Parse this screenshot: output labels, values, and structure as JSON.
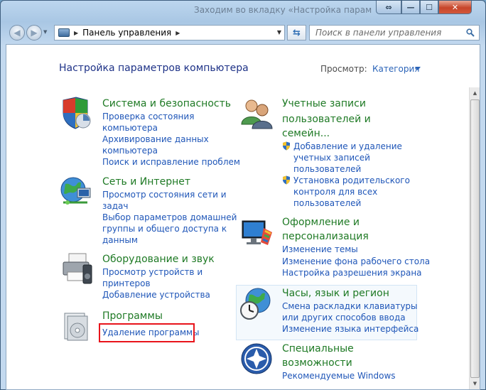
{
  "window": {
    "title": "Заходим во вкладку «Настройка параметров компьютера»",
    "restore_glyph": "⇔",
    "min_glyph": "—",
    "max_glyph": "☐",
    "close_glyph": "✕"
  },
  "nav": {
    "back_glyph": "◀",
    "forward_glyph": "▶",
    "dropdown_glyph": "▼",
    "address": "Панель управления",
    "address_sep": "▶",
    "address_end_sep": "▶",
    "address_drop": "▼",
    "refresh_glyph": "⇆",
    "search_placeholder": "Поиск в панели управления"
  },
  "page": {
    "title": "Настройка параметров компьютера",
    "view_by_label": "Просмотр:",
    "view_by_value": "Категория"
  },
  "categories_left": [
    {
      "title": "Система и безопасность",
      "icon": "system-security-icon",
      "links": [
        "Проверка состояния",
        "компьютера",
        "Архивирование данных",
        "компьютера",
        "Поиск и исправление проблем"
      ]
    },
    {
      "title": "Сеть и Интернет",
      "icon": "network-internet-icon",
      "links": [
        "Просмотр состояния сети и",
        "задач",
        "Выбор параметров домашней",
        "группы и общего доступа к",
        "данным"
      ]
    },
    {
      "title": "Оборудование и звук",
      "icon": "hardware-sound-icon",
      "links": [
        "Просмотр устройств и",
        "принтеров",
        "Добавление устройства"
      ]
    },
    {
      "title": "Программы",
      "icon": "programs-icon",
      "links": [
        "Удаление программы"
      ]
    }
  ],
  "categories_right": [
    {
      "title_lines": [
        "Учетные записи",
        "пользователей и",
        "семейн..."
      ],
      "icon": "user-accounts-icon",
      "links": [
        "Добавление и удаление",
        "учетных записей",
        "пользователей",
        "Установка родительского",
        "контроля для всех",
        "пользователей"
      ]
    },
    {
      "title_lines": [
        "Оформление и",
        "персонализация"
      ],
      "icon": "appearance-icon",
      "links": [
        "Изменение темы",
        "Изменение фона рабочего стола",
        "Настройка разрешения экрана"
      ]
    },
    {
      "title_lines": [
        "Часы, язык и регион"
      ],
      "icon": "clock-region-icon",
      "links": [
        "Смена раскладки клавиатуры",
        "или других способов ввода",
        "Изменение языка интерфейса"
      ]
    },
    {
      "title_lines": [
        "Специальные",
        "возможности"
      ],
      "icon": "ease-of-access-icon",
      "links": [
        "Рекомендуемые Windows"
      ]
    }
  ],
  "colors": {
    "link": "#1f56b8",
    "category_title": "#1f7a25",
    "page_title": "#1e3287",
    "highlight": "#e8141b"
  },
  "scroll": {
    "up_glyph": "▲",
    "down_glyph": "▼"
  }
}
